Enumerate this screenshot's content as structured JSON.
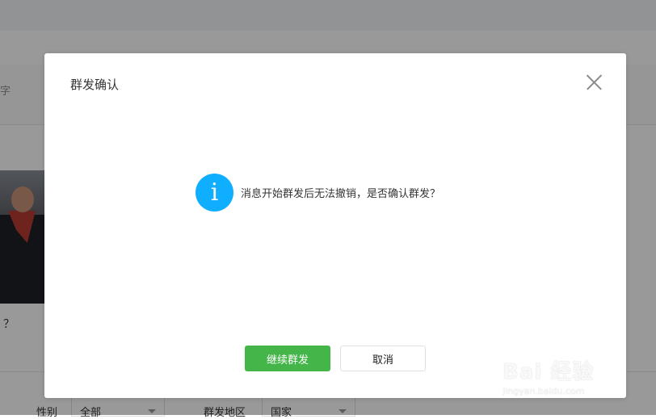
{
  "background": {
    "editor_hint": "字",
    "question_mark": "？",
    "filters": {
      "gender_label": "性别",
      "gender_value": "全部",
      "region_label": "群发地区",
      "region_value": "国家"
    }
  },
  "dialog": {
    "title": "群发确认",
    "message": "消息开始群发后无法撤销，是否确认群发？",
    "info_icon_glyph": "i",
    "confirm_label": "继续群发",
    "cancel_label": "取消",
    "colors": {
      "primary": "#44b549",
      "info": "#10aeff"
    }
  },
  "watermark": {
    "main": "Bai 经验",
    "sub": "jingyan.baidu.com"
  }
}
